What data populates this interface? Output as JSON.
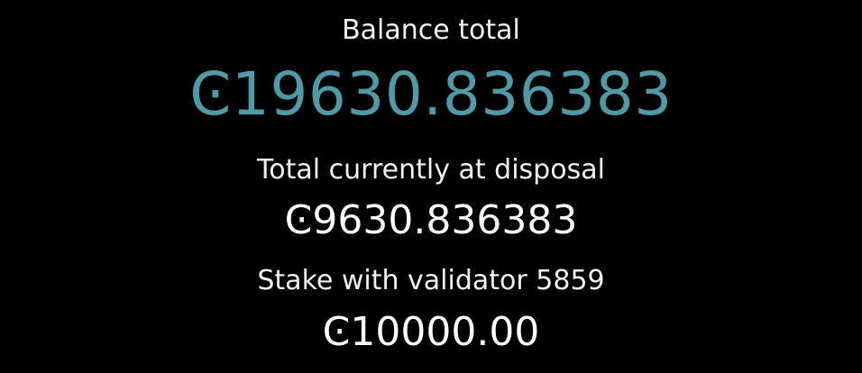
{
  "colors": {
    "background": "#000000",
    "accent": "#4f9aa6",
    "text": "#ffffff"
  },
  "balance": {
    "label": "Balance total",
    "value": "Ͼ19630.836383"
  },
  "disposal": {
    "label": "Total currently at disposal",
    "value": "Ͼ9630.836383"
  },
  "stake": {
    "label": "Stake with validator 5859",
    "value": "Ͼ10000.00"
  }
}
